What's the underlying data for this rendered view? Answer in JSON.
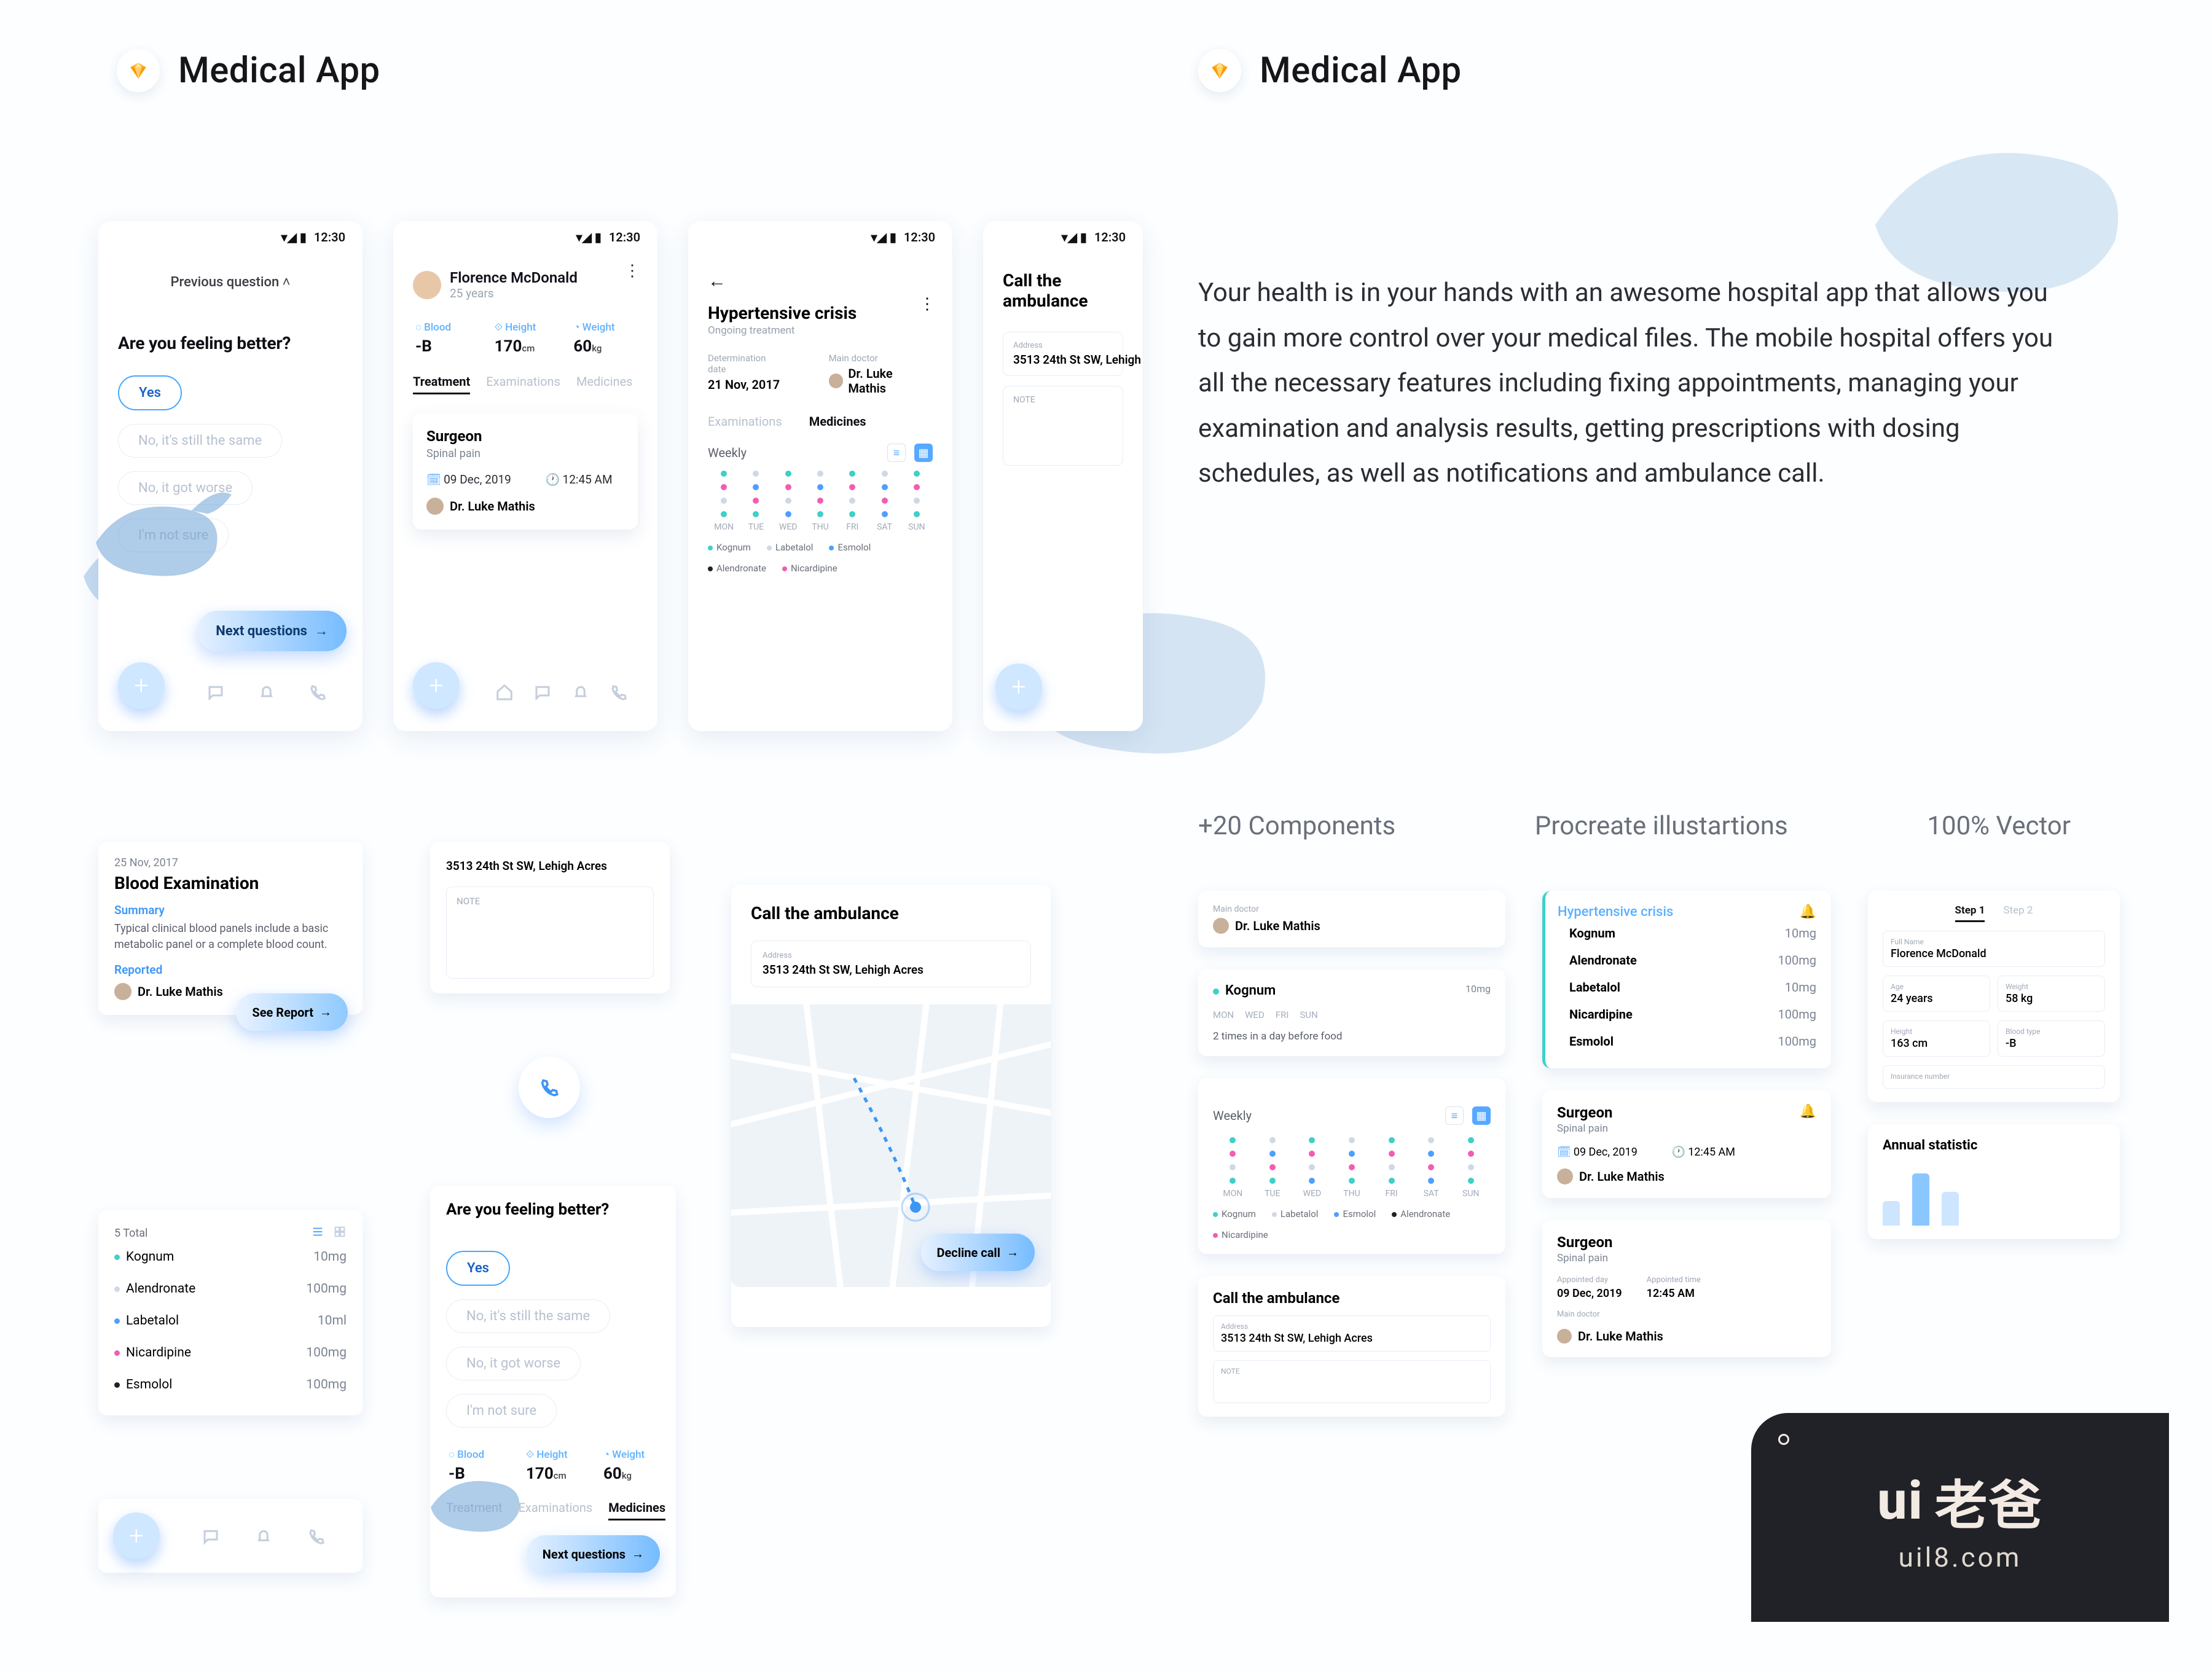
{
  "header": {
    "title": "Medical App"
  },
  "description": "Your health is in your hands with an awesome hospital app that allows you to gain more control over your medical files. The mobile hospital offers you all the necessary features including fixing appointments, managing your examination and analysis results, getting prescriptions with dosing schedules, as well as notifications and ambulance call.",
  "meta": {
    "components": "+20 Components",
    "illustrations": "Procreate illustartions",
    "vector": "100%  Vector"
  },
  "status_time": "12:30",
  "question": {
    "prev": "Previous question   ˄",
    "title": "Are you feeling better?",
    "options": {
      "yes": "Yes",
      "same": "No, it's still the same",
      "worse": "No, it got worse",
      "unsure": "I'm not sure"
    },
    "next": "Next questions"
  },
  "profile": {
    "name": "Florence McDonald",
    "age": "25 years"
  },
  "vitals": {
    "blood": {
      "label": "Blood",
      "value": "-B"
    },
    "height": {
      "label": "Height",
      "value": "170",
      "unit": "cm"
    },
    "weight": {
      "label": "Weight",
      "value": "60",
      "unit": "kg"
    }
  },
  "tabs": {
    "treatment": "Treatment",
    "examinations": "Examinations",
    "medicines": "Medicines"
  },
  "appointment": {
    "role": "Surgeon",
    "reason": "Spinal pain",
    "date": "09 Dec, 2019",
    "time": "12:45 AM",
    "doctor": "Dr. Luke Mathis"
  },
  "crisis": {
    "title": "Hypertensive crisis",
    "subtitle": "Ongoing treatment",
    "det_label": "Determination date",
    "det_value": "21 Nov, 2017",
    "doc_label": "Main doctor",
    "doctor": "Dr. Luke Mathis"
  },
  "weekly": {
    "label": "Weekly",
    "days": [
      "MON",
      "TUE",
      "WED",
      "THU",
      "FRI",
      "SAT",
      "SUN"
    ]
  },
  "legend": {
    "kognum": "Kognum",
    "labetalol": "Labetalol",
    "esmolol": "Esmolol",
    "alendronate": "Alendronate",
    "nicardipine": "Nicardipine"
  },
  "ambulance": {
    "title": "Call the ambulance",
    "addr_label": "Address",
    "address": "3513 24th St SW, Lehigh Acres",
    "note": "NOTE",
    "decline": "Decline call"
  },
  "blood_exam": {
    "date": "25 Nov, 2017",
    "title": "Blood Examination",
    "summary_h": "Summary",
    "summary": "Typical clinical blood panels include a basic metabolic panel or a complete blood count.",
    "reported_h": "Reported",
    "doctor": "Dr. Luke Mathis",
    "report_btn": "See Report"
  },
  "meds_card": {
    "total": "5 Total",
    "rows": [
      {
        "name": "Kognum",
        "dose": "10mg",
        "cls": "m-teal"
      },
      {
        "name": "Alendronate",
        "dose": "100mg",
        "cls": "m-grey"
      },
      {
        "name": "Labetalol",
        "dose": "10ml",
        "cls": "m-blue"
      },
      {
        "name": "Nicardipine",
        "dose": "100mg",
        "cls": "m-pink"
      },
      {
        "name": "Esmolol",
        "dose": "100mg",
        "cls": "m-black"
      }
    ]
  },
  "crisis_meds": [
    {
      "name": "Kognum",
      "dose": "10mg"
    },
    {
      "name": "Alendronate",
      "dose": "100mg"
    },
    {
      "name": "Labetalol",
      "dose": "10mg"
    },
    {
      "name": "Nicardipine",
      "dose": "100mg"
    },
    {
      "name": "Esmolol",
      "dose": "100mg"
    }
  ],
  "kognum_card": {
    "name": "Kognum",
    "dose": "10mg",
    "days": [
      "MON",
      "WED",
      "FRI",
      "SUN"
    ],
    "note": "2 times in a day before food"
  },
  "form": {
    "steps": {
      "s1": "Step 1",
      "s2": "Step 2"
    },
    "fullname": {
      "label": "Full Name",
      "value": "Florence McDonald"
    },
    "age": {
      "label": "Age",
      "value": "24 years"
    },
    "weight": {
      "label": "Weight",
      "value": "58 kg"
    },
    "height": {
      "label": "Height",
      "value": "163 cm"
    },
    "blood": {
      "label": "Blood type",
      "value": "-B"
    },
    "insurance": {
      "label": "Insurance number",
      "value": ""
    }
  },
  "surgeon2": {
    "role": "Surgeon",
    "reason": "Spinal pain",
    "appt_day_l": "Appointed day",
    "appt_day": "09 Dec, 2019",
    "appt_time_l": "Appointed time",
    "appt_time": "12:45 AM",
    "doc_l": "Main doctor",
    "doctor": "Dr. Luke Mathis"
  },
  "annual": {
    "title": "Annual statistic"
  },
  "watermark": {
    "logo": "ui 老爸",
    "site": "uil8.com"
  }
}
